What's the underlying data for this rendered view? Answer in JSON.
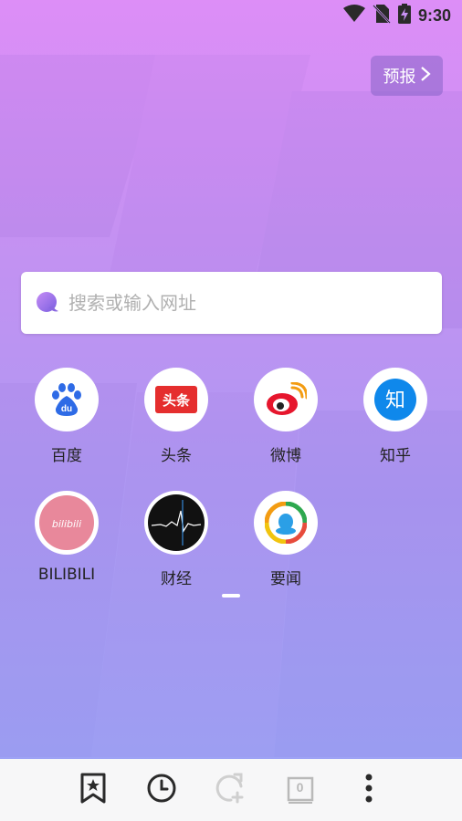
{
  "status_bar": {
    "time": "9:30",
    "icons": [
      "wifi-icon",
      "no-sim-icon",
      "battery-charging-icon"
    ]
  },
  "forecast_button": {
    "label": "预报",
    "icon": "chevron-right-icon"
  },
  "search": {
    "placeholder": "搜索或输入网址",
    "value": "",
    "icon": "browser-logo-icon"
  },
  "shortcuts": [
    {
      "label": "百度",
      "icon": "baidu-icon",
      "icon_text": "du",
      "color": "#2e6be6"
    },
    {
      "label": "头条",
      "icon": "toutiao-icon",
      "icon_text": "头条",
      "color": "#e52e2e"
    },
    {
      "label": "微博",
      "icon": "weibo-icon",
      "color": "#e6162d"
    },
    {
      "label": "知乎",
      "icon": "zhihu-icon",
      "icon_text": "知",
      "color": "#0f88eb"
    },
    {
      "label": "BILIBILI",
      "icon": "bilibili-icon",
      "icon_text": "bilibili",
      "color": "#e8889b"
    },
    {
      "label": "财经",
      "icon": "finance-chart-icon",
      "color": "#111111"
    },
    {
      "label": "要闻",
      "icon": "news-icon",
      "color": "#2b9fe6"
    }
  ],
  "pagination": {
    "current": 1
  },
  "bottom_nav": [
    {
      "name": "bookmarks",
      "icon": "bookmark-star-icon"
    },
    {
      "name": "history",
      "icon": "clock-icon"
    },
    {
      "name": "refresh",
      "icon": "refresh-add-icon"
    },
    {
      "name": "tabs",
      "icon": "tabs-icon",
      "count": "0"
    },
    {
      "name": "menu",
      "icon": "more-vertical-icon"
    }
  ]
}
